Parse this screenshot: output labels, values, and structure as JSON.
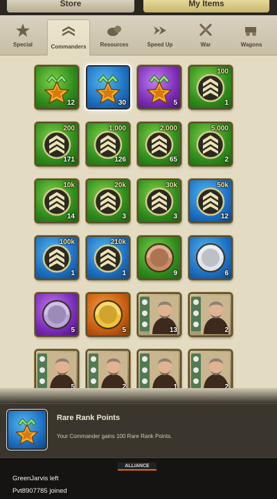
{
  "top_tabs": [
    {
      "label": "Store"
    },
    {
      "label": "My Items"
    }
  ],
  "categories": [
    {
      "label": "Special",
      "icon": "star-icon"
    },
    {
      "label": "Commanders",
      "icon": "chevron-rank-icon",
      "active": true
    },
    {
      "label": "Resources",
      "icon": "resources-icon"
    },
    {
      "label": "Speed Up",
      "icon": "speed-up-icon"
    },
    {
      "label": "War",
      "icon": "crossed-swords-icon"
    },
    {
      "label": "Wagons",
      "icon": "wagon-icon"
    }
  ],
  "items": {
    "r1": [
      {
        "icon": "star-rank-green-icon",
        "qty": "12"
      },
      {
        "icon": "star-rank-blue-icon",
        "qty": "30",
        "selected": true
      },
      {
        "icon": "star-rank-purple-icon",
        "qty": "5"
      },
      {
        "icon": "xp-chevron-icon",
        "amount": "100",
        "qty": "1"
      }
    ],
    "r2": [
      {
        "icon": "xp-chevron-icon",
        "amount": "200",
        "qty": "171"
      },
      {
        "icon": "xp-chevron-icon",
        "amount": "1,000",
        "qty": "126"
      },
      {
        "icon": "xp-chevron-icon",
        "amount": "2,000",
        "qty": "65"
      },
      {
        "icon": "xp-chevron-icon",
        "amount": "5,000",
        "qty": "2"
      }
    ],
    "r3": [
      {
        "icon": "xp-chevron-icon",
        "amount": "10k",
        "qty": "14"
      },
      {
        "icon": "xp-chevron-icon",
        "amount": "20k",
        "qty": "3"
      },
      {
        "icon": "xp-chevron-icon",
        "amount": "30k",
        "qty": "3"
      },
      {
        "icon": "xp-chevron-icon",
        "amount": "50k",
        "qty": "12"
      }
    ],
    "r4": [
      {
        "icon": "xp-chevron-icon",
        "amount": "100k",
        "qty": "1"
      },
      {
        "icon": "xp-chevron-icon",
        "amount": "210k",
        "qty": "1"
      },
      {
        "icon": "bronze-medal-icon",
        "qty": "9"
      },
      {
        "icon": "silver-medal-icon",
        "qty": "6"
      }
    ],
    "r5": [
      {
        "icon": "purple-medal-icon",
        "qty": "5"
      },
      {
        "icon": "gold-medal-icon",
        "qty": "5"
      },
      {
        "icon": "commander-portrait-icon",
        "qty": "13"
      },
      {
        "icon": "commander-portrait-icon",
        "qty": "2"
      }
    ],
    "r6": [
      {
        "icon": "commander-portrait-icon",
        "qty": "5"
      },
      {
        "icon": "commander-portrait-icon",
        "qty": "2"
      },
      {
        "icon": "commander-portrait-icon",
        "qty": "1"
      },
      {
        "icon": "commander-portrait-icon",
        "qty": "2"
      }
    ]
  },
  "info": {
    "title": "Rare Rank Points",
    "description": "Your Commander gains 100 Rare Rank Points."
  },
  "chat": {
    "tab": "ALLIANCE",
    "lines": [
      "GreenJarvis left",
      "Pvt8907785 joined"
    ]
  },
  "colors": {
    "green": "#2f8c1c",
    "blue": "#1d70c2",
    "purple": "#7a2cb8",
    "orange": "#c75d10",
    "accent": "#e36b1a"
  }
}
